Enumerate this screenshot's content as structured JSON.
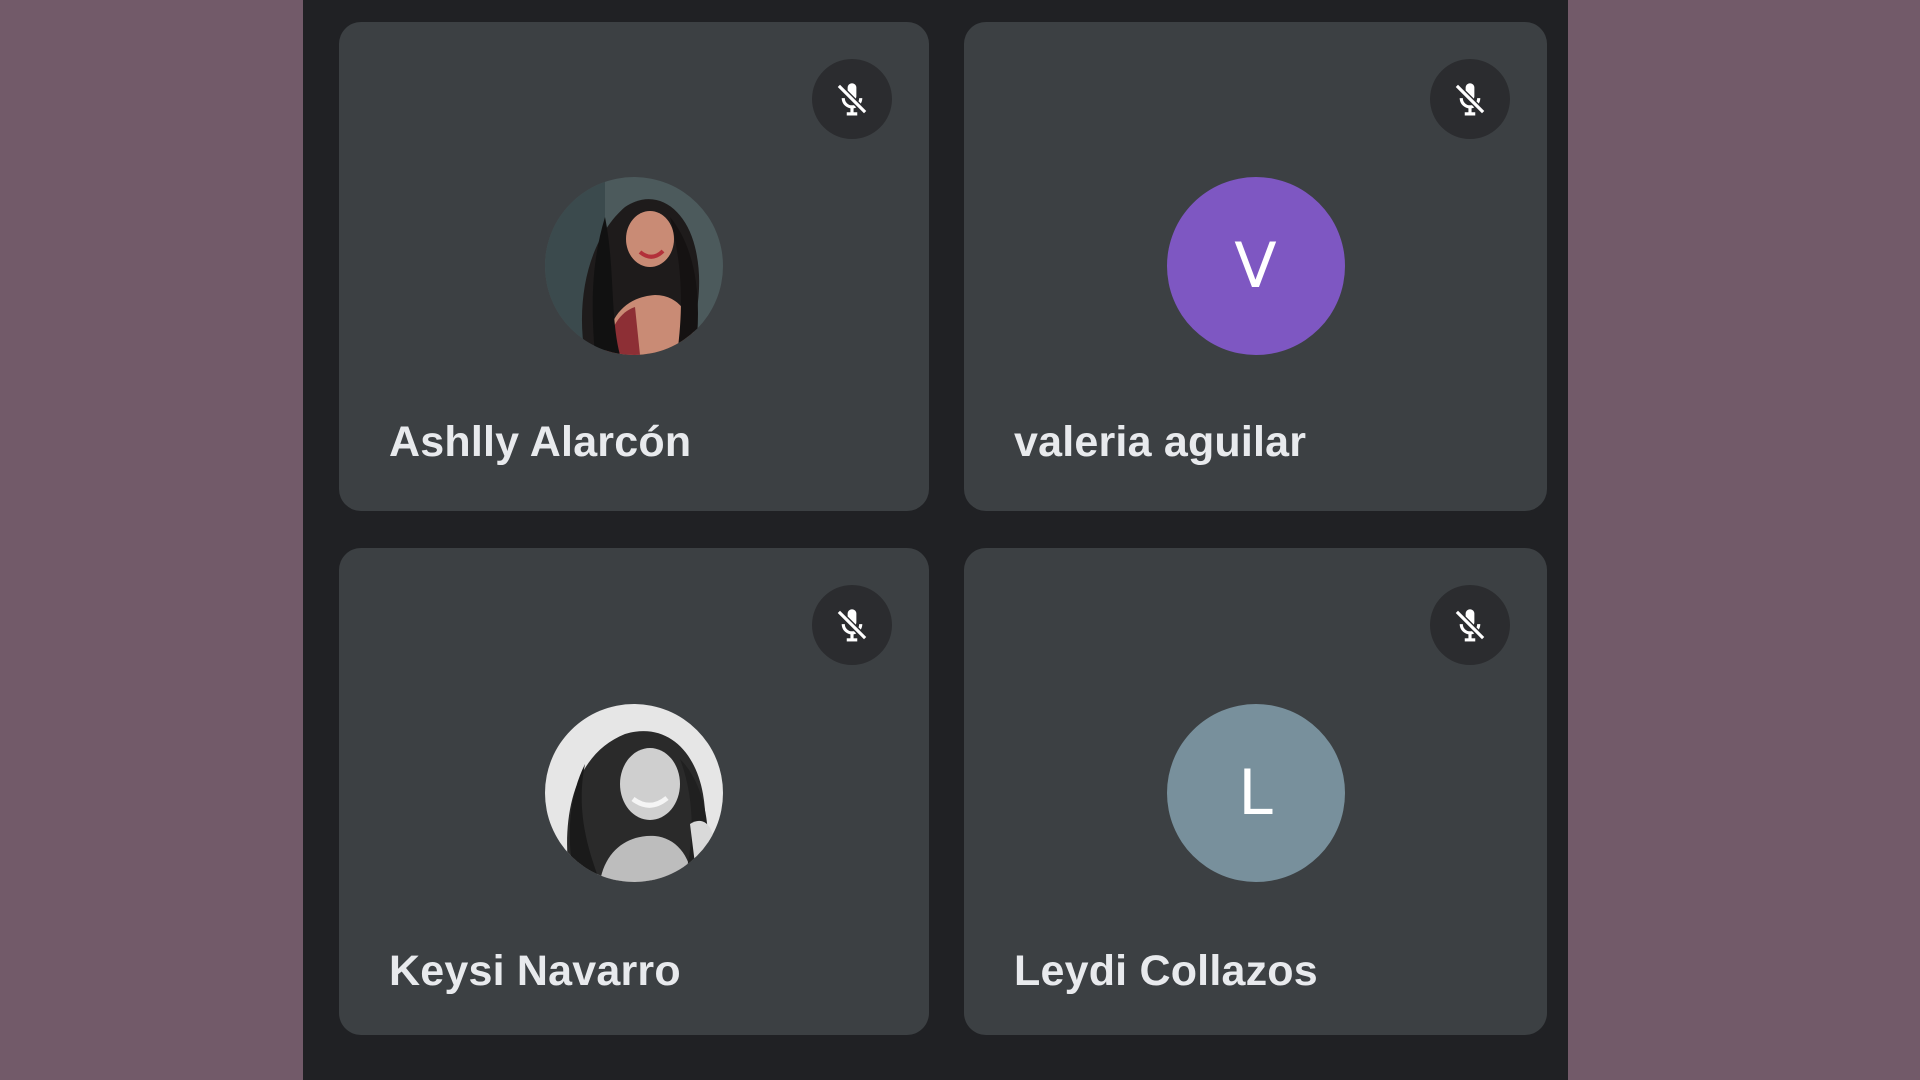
{
  "meeting": {
    "participants": [
      {
        "name": "Ashlly Alarcón",
        "avatar": {
          "type": "photo",
          "tones": [
            "#2d2a29",
            "#c98b75",
            "#8d2f35"
          ]
        },
        "mic": {
          "icon": "mic-off-icon",
          "state": "muted"
        }
      },
      {
        "name": "valeria aguilar",
        "avatar": {
          "type": "initial",
          "letter": "V",
          "color": "#7e57c2"
        },
        "mic": {
          "icon": "mic-off-icon",
          "state": "muted"
        }
      },
      {
        "name": "Keysi Navarro",
        "avatar": {
          "type": "photo",
          "tones": [
            "#1f1f1f",
            "#cfcfcf",
            "#e9e9e9"
          ]
        },
        "mic": {
          "icon": "mic-off-icon",
          "state": "muted"
        }
      },
      {
        "name": "Leydi Collazos",
        "avatar": {
          "type": "initial",
          "letter": "L",
          "color": "#78909c"
        },
        "mic": {
          "icon": "mic-off-icon",
          "state": "muted"
        }
      }
    ]
  },
  "colors": {
    "page_background": "#725a69",
    "stage_background": "#202124",
    "tile_background": "#3c4043",
    "mute_badge_background": "#2b2c2f",
    "name_text": "#e8eaed"
  }
}
